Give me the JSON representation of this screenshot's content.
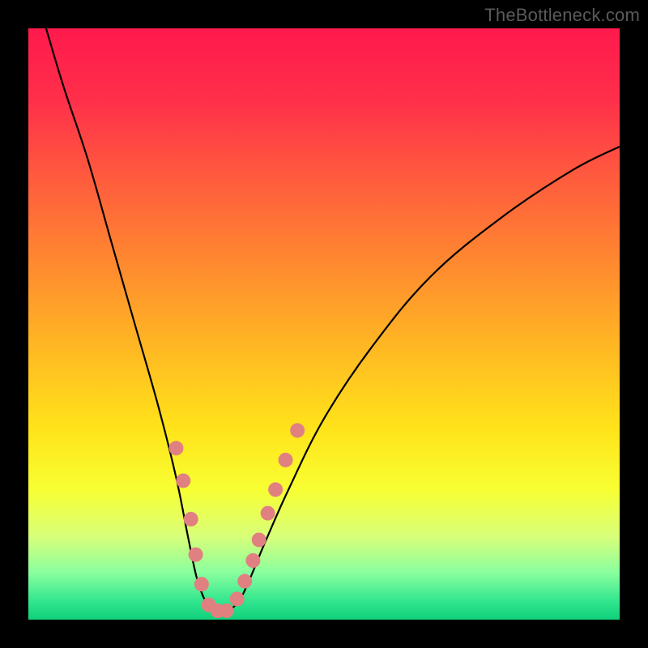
{
  "watermark": "TheBottleneck.com",
  "gradient": {
    "stops": [
      {
        "offset": 0.0,
        "color": "#ff1a4d"
      },
      {
        "offset": 0.12,
        "color": "#ff2f4a"
      },
      {
        "offset": 0.25,
        "color": "#ff5a3e"
      },
      {
        "offset": 0.4,
        "color": "#ff8a2f"
      },
      {
        "offset": 0.55,
        "color": "#ffbb22"
      },
      {
        "offset": 0.68,
        "color": "#ffe41a"
      },
      {
        "offset": 0.78,
        "color": "#f7ff33"
      },
      {
        "offset": 0.86,
        "color": "#d8ff7a"
      },
      {
        "offset": 0.92,
        "color": "#8aff9e"
      },
      {
        "offset": 0.97,
        "color": "#30e58e"
      },
      {
        "offset": 1.0,
        "color": "#11d07a"
      }
    ]
  },
  "chart_data": {
    "type": "line",
    "title": "",
    "xlabel": "",
    "ylabel": "",
    "xlim": [
      0,
      100
    ],
    "ylim": [
      0,
      100
    ],
    "series": [
      {
        "name": "bottleneck-curve",
        "x": [
          3,
          6,
          10,
          14,
          18,
          22,
          25,
          27,
          28.5,
          30,
          31.5,
          33,
          35.5,
          37.5,
          40,
          44,
          50,
          58,
          68,
          80,
          92,
          100
        ],
        "y": [
          100,
          90,
          78,
          64,
          50,
          36,
          24,
          14,
          7,
          3,
          1,
          1,
          3,
          7,
          13,
          22,
          34,
          46,
          58,
          68,
          76,
          80
        ]
      }
    ],
    "markers": [
      {
        "x": 25.0,
        "y": 29.0
      },
      {
        "x": 26.2,
        "y": 23.5
      },
      {
        "x": 27.5,
        "y": 17.0
      },
      {
        "x": 28.3,
        "y": 11.0
      },
      {
        "x": 29.3,
        "y": 6.0
      },
      {
        "x": 30.5,
        "y": 2.5
      },
      {
        "x": 32.0,
        "y": 1.5
      },
      {
        "x": 33.5,
        "y": 1.5
      },
      {
        "x": 35.3,
        "y": 3.5
      },
      {
        "x": 36.6,
        "y": 6.5
      },
      {
        "x": 38.0,
        "y": 10.0
      },
      {
        "x": 39.0,
        "y": 13.5
      },
      {
        "x": 40.5,
        "y": 18.0
      },
      {
        "x": 41.8,
        "y": 22.0
      },
      {
        "x": 43.5,
        "y": 27.0
      },
      {
        "x": 45.5,
        "y": 32.0
      }
    ]
  },
  "colors": {
    "marker": "#e18080",
    "curve": "#000000"
  }
}
